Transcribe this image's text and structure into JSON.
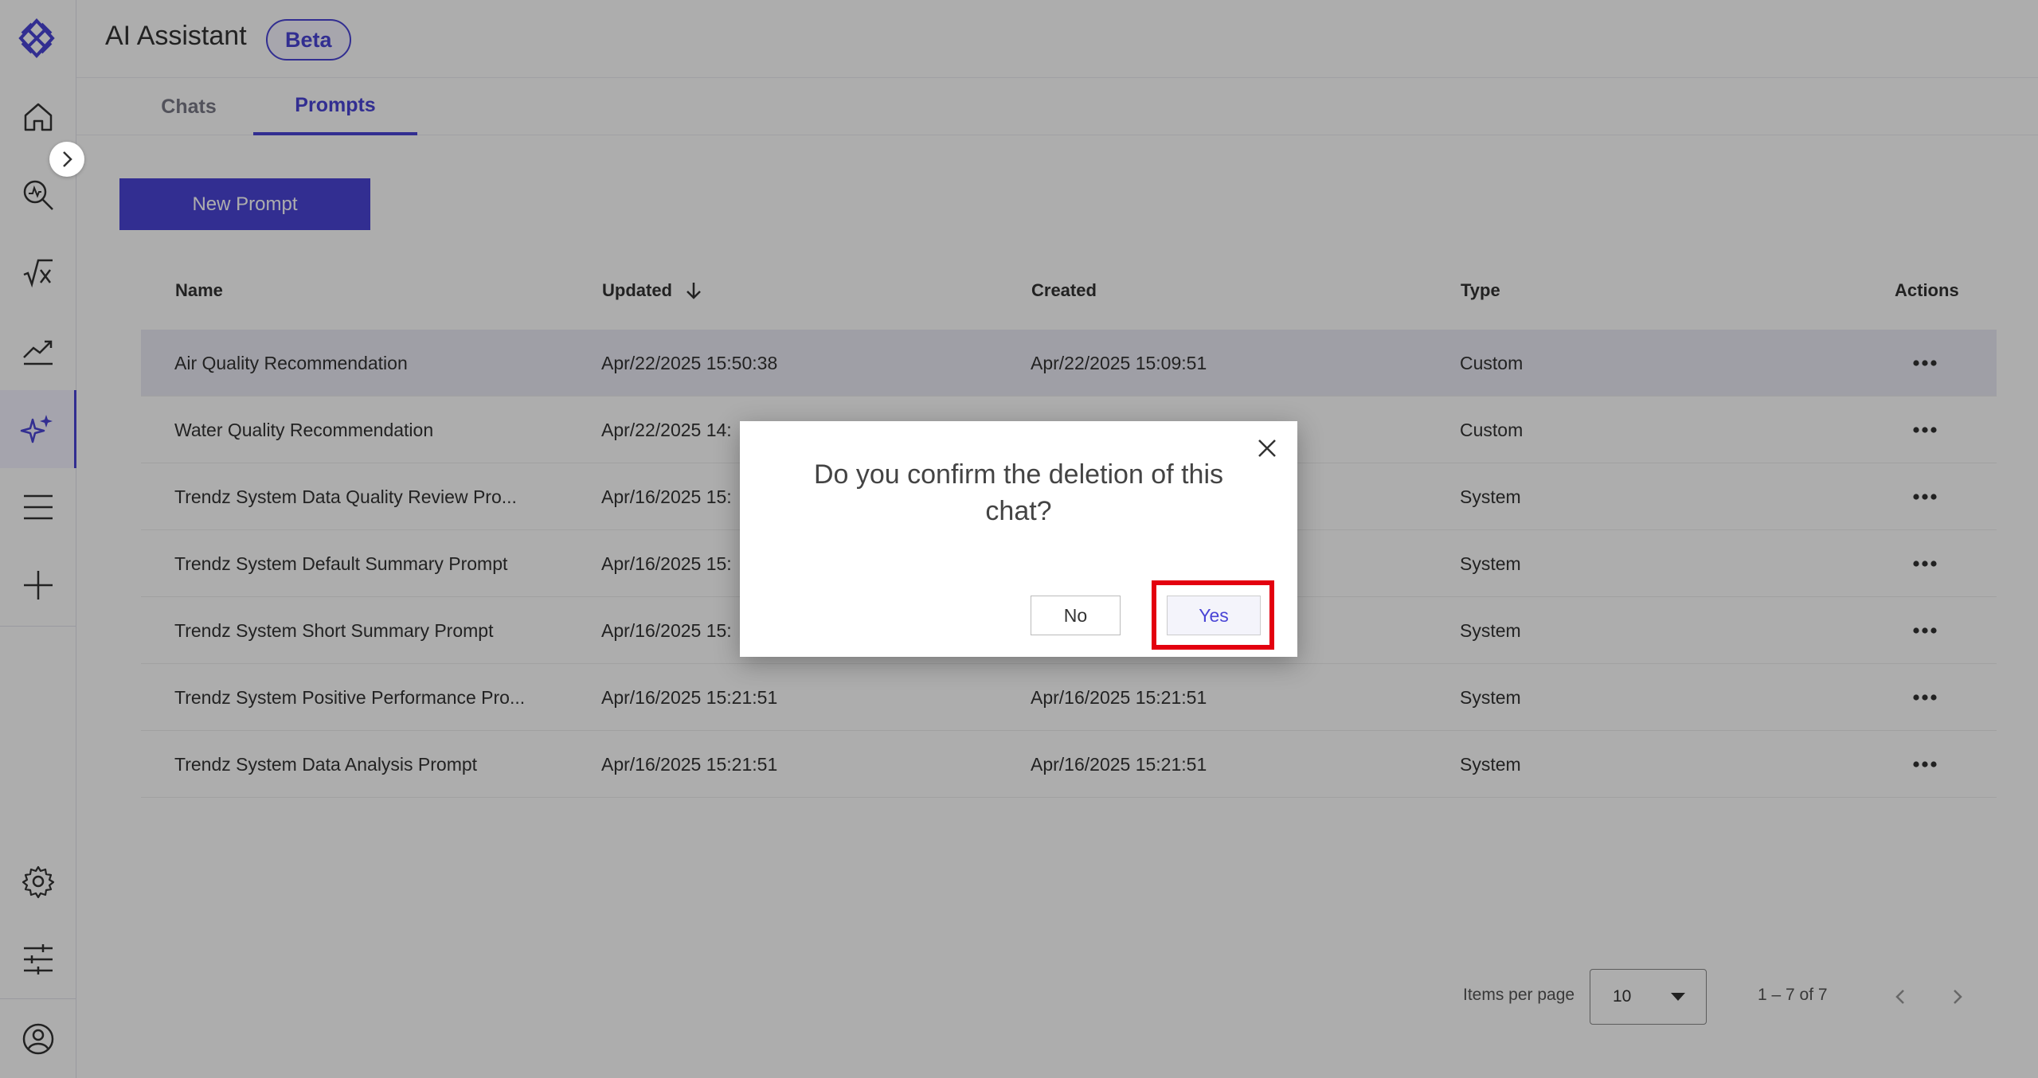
{
  "header": {
    "title": "AI Assistant",
    "badge": "Beta"
  },
  "tabs": [
    {
      "label": "Chats",
      "active": false
    },
    {
      "label": "Prompts",
      "active": true
    }
  ],
  "toolbar": {
    "new_prompt_label": "New Prompt"
  },
  "sidebar": {
    "items": [
      {
        "icon": "home-icon"
      },
      {
        "icon": "search-analysis-icon"
      },
      {
        "icon": "formula-icon"
      },
      {
        "icon": "trend-chart-icon"
      },
      {
        "icon": "sparkles-icon",
        "active": true
      },
      {
        "icon": "menu-icon"
      },
      {
        "icon": "plus-icon"
      }
    ],
    "bottom_items": [
      {
        "icon": "gear-icon"
      },
      {
        "icon": "sliders-icon"
      },
      {
        "icon": "user-icon"
      }
    ]
  },
  "table": {
    "columns": [
      "Name",
      "Updated",
      "Created",
      "Type",
      "Actions"
    ],
    "sort": {
      "column": "Updated",
      "direction": "desc"
    },
    "rows": [
      {
        "name": "Air Quality Recommendation",
        "updated": "Apr/22/2025 15:50:38",
        "created": "Apr/22/2025 15:09:51",
        "type": "Custom"
      },
      {
        "name": "Water Quality Recommendation",
        "updated": "Apr/22/2025 14:",
        "created": "",
        "type": "Custom"
      },
      {
        "name": "Trendz System Data Quality Review Pro...",
        "updated": "Apr/16/2025 15:",
        "created": "",
        "type": "System"
      },
      {
        "name": "Trendz System Default Summary Prompt",
        "updated": "Apr/16/2025 15:",
        "created": "",
        "type": "System"
      },
      {
        "name": "Trendz System Short Summary Prompt",
        "updated": "Apr/16/2025 15:",
        "created": "",
        "type": "System"
      },
      {
        "name": "Trendz System Positive Performance Pro...",
        "updated": "Apr/16/2025 15:21:51",
        "created": "Apr/16/2025 15:21:51",
        "type": "System"
      },
      {
        "name": "Trendz System Data Analysis Prompt",
        "updated": "Apr/16/2025 15:21:51",
        "created": "Apr/16/2025 15:21:51",
        "type": "System"
      }
    ]
  },
  "pagination": {
    "items_per_page_label": "Items per page",
    "items_per_page": "10",
    "range": "1 – 7 of 7"
  },
  "dialog": {
    "message": "Do you confirm the deletion of this chat?",
    "no_label": "No",
    "yes_label": "Yes"
  },
  "colors": {
    "accent": "#4a45d6",
    "highlight": "#e3000f"
  }
}
